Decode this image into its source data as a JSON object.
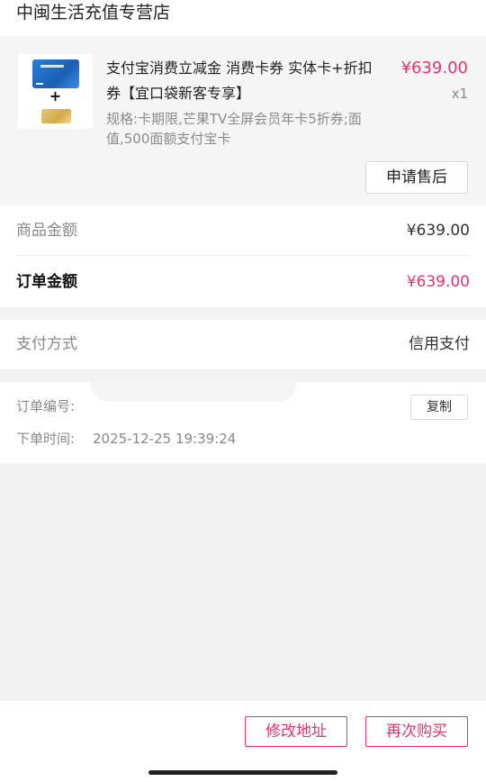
{
  "store": {
    "name": "中闽生活充值专营店"
  },
  "product": {
    "title": "支付宝消费立减金 消费卡券 实体卡+折扣券【宜口袋新客专享】",
    "price": "¥639.00",
    "quantity": "x1",
    "spec": "规格:卡期限,芒果TV全屏会员年卡5折券;面值,500面额支付宝卡",
    "after_sale_label": "申请售后"
  },
  "amounts": {
    "goods_label": "商品金额",
    "goods_value": "¥639.00",
    "order_label": "订单金额",
    "order_value": "¥639.00"
  },
  "payment": {
    "label": "支付方式",
    "value": "信用支付"
  },
  "order_info": {
    "number_label": "订单编号:",
    "copy_label": "复制",
    "time_label": "下单时间:",
    "time_value": "2025-12-25 19:39:24"
  },
  "actions": {
    "modify_address_label": "修改地址",
    "rebuy_label": "再次购买"
  },
  "colors": {
    "accent": "#e8336c",
    "page_bg": "#f2f2f2"
  }
}
